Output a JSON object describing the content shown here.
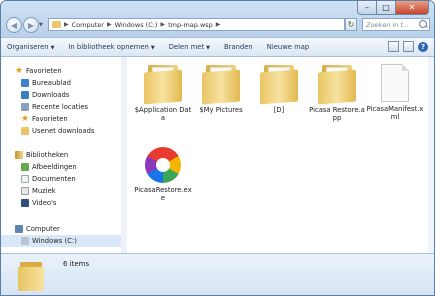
{
  "addressbar": {
    "segments": [
      "Computer",
      "Windows (C:)",
      "tmp-map.wsp"
    ]
  },
  "search": {
    "placeholder": "Zoeken in t..."
  },
  "toolbar": {
    "organize": "Organiseren",
    "include_library": "In bibliotheek opnemen",
    "share": "Delen met",
    "burn": "Branden",
    "new_folder": "Nieuwe map"
  },
  "navpane": {
    "favorites": "Favorieten",
    "desktop": "Bureaublad",
    "downloads": "Downloads",
    "recent": "Recente locaties",
    "fav2": "Favorieten",
    "usenet": "Usenet downloads",
    "libraries": "Bibliotheken",
    "images": "Afbeeldingen",
    "documents": "Documenten",
    "music": "Muziek",
    "videos": "Video's",
    "computer": "Computer",
    "drive": "Windows (C:)"
  },
  "files": [
    {
      "name": "$Application Data",
      "icon": "folder-icon"
    },
    {
      "name": "$My Pictures",
      "icon": "folder-icon"
    },
    {
      "name": "[D]",
      "icon": "folder-icon"
    },
    {
      "name": "Picasa Restore.app",
      "icon": "folder-icon"
    },
    {
      "name": "PicasaManifest.xml",
      "icon": "document-icon"
    },
    {
      "name": "PicasaRestore.exe",
      "icon": "picasa-app-icon"
    }
  ],
  "status": {
    "item_count": "6 items"
  },
  "colors": {
    "accent": "#1e395b",
    "selection": "#d9e8f8",
    "folder": "#e9c563"
  }
}
